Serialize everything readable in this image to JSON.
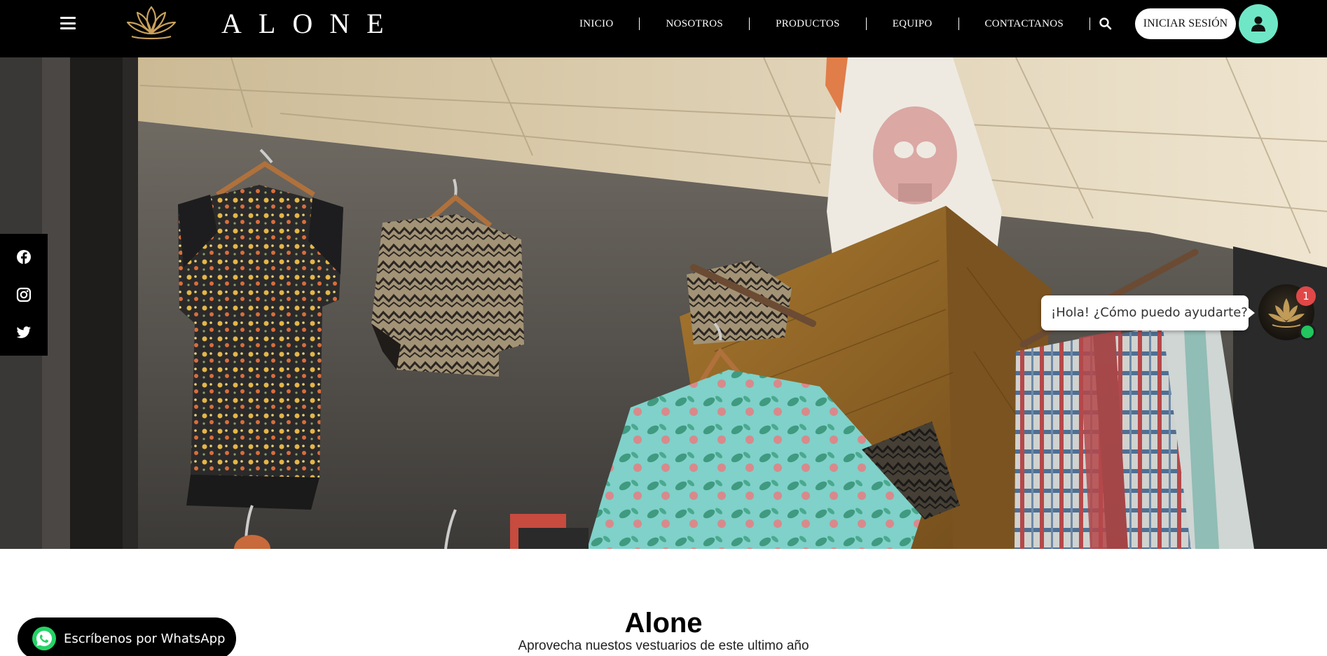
{
  "header": {
    "brand": "ALONE",
    "nav": [
      {
        "label": "INICIO"
      },
      {
        "label": "NOSOTROS"
      },
      {
        "label": "PRODUCTOS"
      },
      {
        "label": "EQUIPO"
      },
      {
        "label": "CONTACTANOS"
      }
    ],
    "login_label": "INICIAR SESIÓN"
  },
  "icons": {
    "menu": "hamburger-icon",
    "logo": "lotus-logo-icon",
    "search": "search-icon",
    "user": "user-icon",
    "social": [
      "facebook-icon",
      "instagram-icon",
      "twitter-icon"
    ],
    "whatsapp": "whatsapp-icon"
  },
  "chat": {
    "greeting": "¡Hola! ¿Cómo puedo ayudarte?",
    "badge": "1"
  },
  "main": {
    "title": "Alone",
    "subtitle": "Aprovecha nuestos vestuarios de este ultimo año"
  },
  "whatsapp": {
    "label": "Escríbenos por WhatsApp"
  },
  "colors": {
    "navbar": "#000000",
    "accent": "#6fe7c6",
    "badge": "#e04848",
    "online": "#22c55e",
    "lotus_gold": "#c9a15b"
  }
}
